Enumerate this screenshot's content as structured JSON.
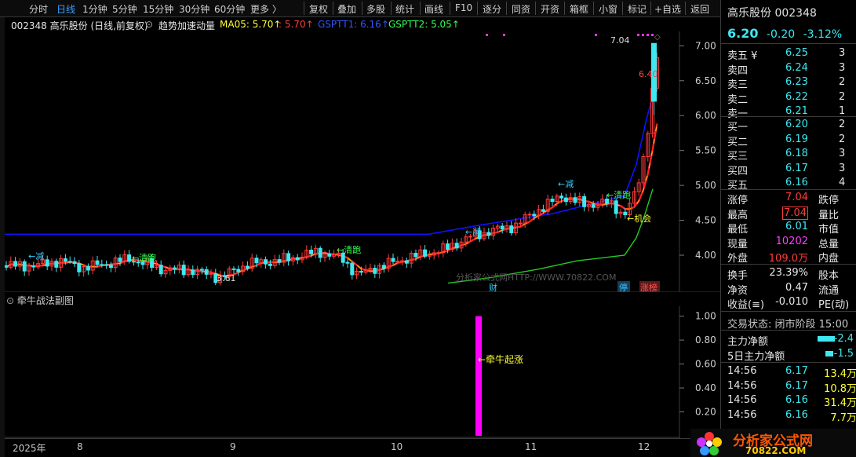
{
  "toolbar": {
    "items": [
      "分时",
      "日线",
      "1分钟",
      "5分钟",
      "15分钟",
      "30分钟",
      "60分钟",
      "更多 〉",
      "复权",
      "叠加",
      "多股",
      "统计",
      "画线",
      "F10",
      "逐分",
      "同资",
      "开资",
      "箱框",
      "小窗",
      "标记",
      "+自选",
      "返回"
    ],
    "active_index": 1
  },
  "chart_header": {
    "stock": "002348 高乐股份 (日线,前复权)",
    "indicator": "趋势加速动量",
    "ma05": "MA05: 5.70↑",
    "ma_b": ": 5.70↑",
    "gsptt1": "GSPTT1: 6.16↑",
    "gsptt2": "GSPTT2: 5.05↑"
  },
  "annotations": {
    "high_label": "7.04",
    "low_label": "3.61",
    "cur_label": "6.40",
    "signals": [
      {
        "text": "←减"
      },
      {
        "text": "←清跑"
      },
      {
        "text": "←清跑"
      },
      {
        "text": "←减"
      },
      {
        "text": "←减"
      },
      {
        "text": "←清跑"
      },
      {
        "text": "←机会"
      }
    ],
    "badges": {
      "cai": "财",
      "ting": "停",
      "zhangbang": "涨榜"
    },
    "watermark": "分析家公式网HTTP://WWW.70822.COM"
  },
  "sub_chart": {
    "title": "牵牛战法副图",
    "signal_label": "←牵牛起涨"
  },
  "x_axis": {
    "labels": [
      "2025年",
      "8",
      "9",
      "10",
      "11",
      "12"
    ]
  },
  "chart_data": [
    {
      "type": "candlestick",
      "ylim": [
        3.55,
        7.15
      ],
      "y_ticks": [
        "7.00",
        "6.50",
        "6.00",
        "5.50",
        "5.00",
        "4.50",
        "4.00"
      ],
      "y_tick_values": [
        7.0,
        6.5,
        6.0,
        5.5,
        5.0,
        4.5,
        4.0
      ],
      "series": [
        {
          "name": "MA05",
          "color": "#ffaa00"
        },
        {
          "name": "GSPTT1",
          "color": "#0000ff"
        },
        {
          "name": "GSPTT2",
          "color": "#00ee00"
        }
      ],
      "last_close": 6.2,
      "high": 7.04,
      "low": 3.61
    },
    {
      "type": "bar",
      "title": "牵牛战法副图",
      "ylim": [
        0.0,
        1.05
      ],
      "y_ticks": [
        "1.00",
        "0.80",
        "0.60",
        "0.40",
        "0.20"
      ],
      "y_tick_values": [
        1.0,
        0.8,
        0.6,
        0.4,
        0.2
      ],
      "values": [
        1.0
      ],
      "color": "#ff00ff"
    }
  ],
  "right_panel": {
    "name": "高乐股份 002348",
    "price": "6.20",
    "change": "-0.20",
    "change_pct": "-3.12%",
    "asks": [
      {
        "label": "卖五 ¥",
        "price": "6.25",
        "vol": "3"
      },
      {
        "label": "卖四",
        "price": "6.24",
        "vol": "3"
      },
      {
        "label": "卖三",
        "price": "6.23",
        "vol": "2"
      },
      {
        "label": "卖二",
        "price": "6.22",
        "vol": "2"
      },
      {
        "label": "卖一",
        "price": "6.21",
        "vol": "1"
      }
    ],
    "bids": [
      {
        "label": "买一",
        "price": "6.20",
        "vol": "2"
      },
      {
        "label": "买二",
        "price": "6.19",
        "vol": "2"
      },
      {
        "label": "买三",
        "price": "6.18",
        "vol": "3"
      },
      {
        "label": "买四",
        "price": "6.17",
        "vol": "3"
      },
      {
        "label": "买五",
        "price": "6.16",
        "vol": "4"
      }
    ],
    "stats1": [
      {
        "l": "涨停",
        "v": "7.04",
        "r": "跌停"
      },
      {
        "l": "最高",
        "v": "7.04",
        "r": "量比"
      },
      {
        "l": "最低",
        "v": "6.01",
        "r": "市值"
      },
      {
        "l": "现量",
        "v": "10202",
        "r": "总量"
      },
      {
        "l": "外盘",
        "v": "109.0万",
        "r": "内盘"
      }
    ],
    "stats2": [
      {
        "l": "换手",
        "v": "23.39%",
        "r": "股本"
      },
      {
        "l": "净资",
        "v": "0.47",
        "r": "流通"
      },
      {
        "l": "收益(≡)",
        "v": "-0.010",
        "r": "PE(动)"
      }
    ],
    "trade_status": "交易状态: 闭市阶段 15:00",
    "flows": [
      {
        "l": "主力净额",
        "v": "-2.4"
      },
      {
        "l": "5日主力净额",
        "v": "-1.5"
      }
    ],
    "ticks": [
      {
        "t": "14:56",
        "p": "6.17",
        "v": "13.4万"
      },
      {
        "t": "14:56",
        "p": "6.17",
        "v": "10.8万"
      },
      {
        "t": "14:56",
        "p": "6.16",
        "v": "31.4万"
      },
      {
        "t": "14:56",
        "p": "6.16",
        "v": "7.7万"
      }
    ]
  },
  "logo": {
    "text": "分析家公式网",
    "url": "70822.COM"
  }
}
